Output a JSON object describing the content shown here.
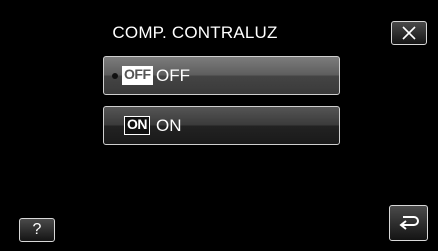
{
  "header": {
    "title": "COMP. CONTRALUZ",
    "close_icon": "close-icon"
  },
  "options": [
    {
      "icon_text": "OFF",
      "label": "OFF",
      "selected": true
    },
    {
      "icon_text": "ON",
      "label": "ON",
      "selected": false
    }
  ],
  "footer": {
    "help_label": "?",
    "back_icon": "return-arrow-icon"
  },
  "colors": {
    "background": "#000000",
    "button_border": "#d8d8d8",
    "text": "#ffffff"
  }
}
